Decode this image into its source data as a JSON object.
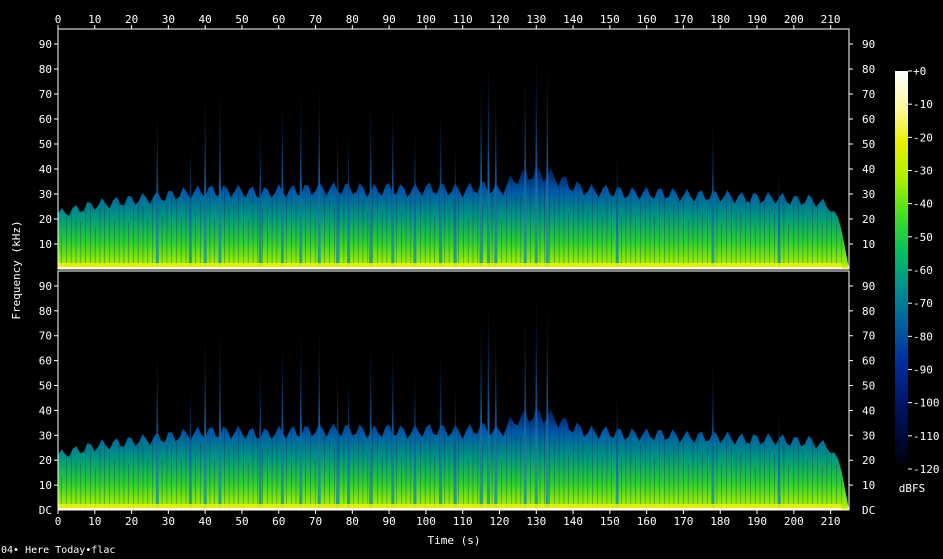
{
  "file": {
    "name": "04• Here Today•flac"
  },
  "chart_data": {
    "type": "heatmap",
    "subtype": "spectrogram",
    "channels": 2,
    "xlabel": "Time (s)",
    "ylabel": "Frequency (kHz)",
    "colorbar_label": "dBFS",
    "duration_s": 215,
    "xlim": [
      0,
      215
    ],
    "ylim": [
      0,
      96
    ],
    "x_ticks": [
      0,
      10,
      20,
      30,
      40,
      50,
      60,
      70,
      80,
      90,
      100,
      110,
      120,
      130,
      140,
      150,
      160,
      170,
      180,
      190,
      200,
      210
    ],
    "y_ticks": [
      10,
      20,
      30,
      40,
      50,
      60,
      70,
      80,
      90
    ],
    "y_bottom_label": "DC",
    "colorbar_range": [
      -120,
      0
    ],
    "colorbar_ticks": [
      "+0",
      "-10",
      "-20",
      "-30",
      "-40",
      "-50",
      "-60",
      "-70",
      "-80",
      "-90",
      "-100",
      "-110",
      "-120"
    ],
    "colormap_stops": [
      "#ffffff",
      "#fff9a0",
      "#e8f000",
      "#a8f000",
      "#40e020",
      "#00c060",
      "#009090",
      "#0060a0",
      "#0030a0",
      "#001870",
      "#000a40",
      "#000000"
    ],
    "bandlimit_profile": {
      "t": [
        0,
        5,
        10,
        15,
        20,
        25,
        30,
        35,
        40,
        45,
        50,
        55,
        60,
        65,
        70,
        75,
        80,
        85,
        90,
        95,
        100,
        105,
        110,
        115,
        120,
        125,
        130,
        135,
        140,
        145,
        150,
        155,
        160,
        165,
        170,
        175,
        180,
        185,
        190,
        195,
        200,
        205,
        210,
        213,
        215
      ],
      "khz": [
        24,
        26,
        28,
        29,
        30,
        31,
        32,
        33,
        34,
        34,
        34,
        33,
        34,
        34,
        35,
        35,
        35,
        34,
        35,
        34,
        35,
        35,
        34,
        36,
        34,
        40,
        42,
        40,
        36,
        34,
        34,
        33,
        33,
        33,
        32,
        32,
        32,
        31,
        31,
        31,
        30,
        30,
        27,
        18,
        0
      ]
    },
    "transient_peaks": [
      {
        "t": 27,
        "khz": 70
      },
      {
        "t": 36,
        "khz": 55
      },
      {
        "t": 40,
        "khz": 78
      },
      {
        "t": 44,
        "khz": 80
      },
      {
        "t": 55,
        "khz": 65
      },
      {
        "t": 61,
        "khz": 75
      },
      {
        "t": 66,
        "khz": 80
      },
      {
        "t": 71,
        "khz": 82
      },
      {
        "t": 76,
        "khz": 62
      },
      {
        "t": 79,
        "khz": 60
      },
      {
        "t": 85,
        "khz": 75
      },
      {
        "t": 91,
        "khz": 73
      },
      {
        "t": 97,
        "khz": 62
      },
      {
        "t": 104,
        "khz": 70
      },
      {
        "t": 108,
        "khz": 55
      },
      {
        "t": 115,
        "khz": 85
      },
      {
        "t": 117,
        "khz": 92
      },
      {
        "t": 119,
        "khz": 80
      },
      {
        "t": 127,
        "khz": 88
      },
      {
        "t": 130,
        "khz": 95
      },
      {
        "t": 133,
        "khz": 92
      },
      {
        "t": 152,
        "khz": 52
      },
      {
        "t": 178,
        "khz": 65
      },
      {
        "t": 196,
        "khz": 45
      }
    ]
  }
}
